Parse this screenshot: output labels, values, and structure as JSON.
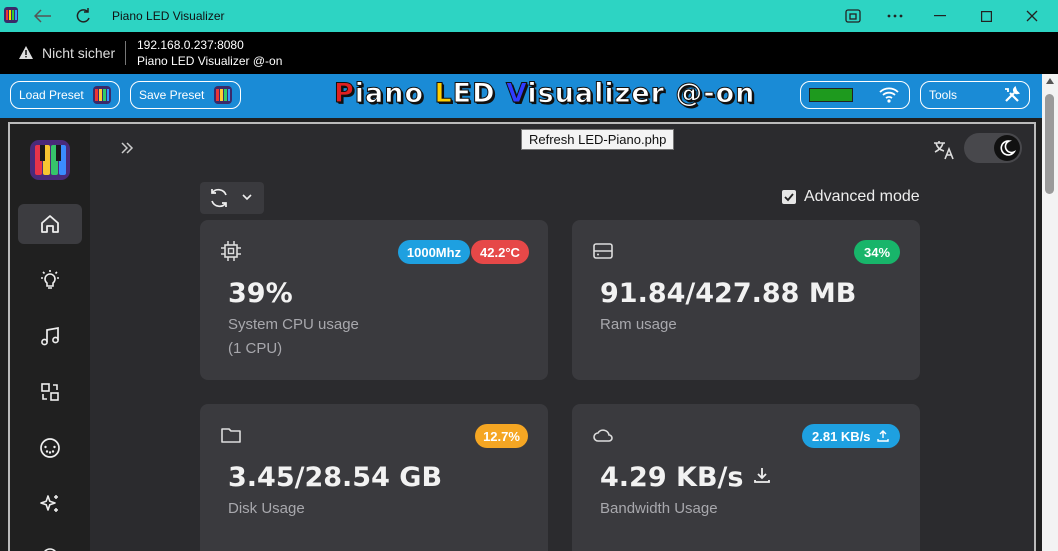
{
  "window": {
    "title": "Piano LED Visualizer"
  },
  "address": {
    "security": "Nicht sicher",
    "url": "192.168.0.237:8080",
    "page_title": "Piano LED Visualizer @-on"
  },
  "header": {
    "load_preset": "Load Preset",
    "save_preset": "Save Preset",
    "brand": {
      "p": "P",
      "iano": "iano ",
      "l": "L",
      "ed": "ED ",
      "v": "V",
      "isualizer": "isualizer @-on"
    },
    "tools": "Tools",
    "status_color": "#1e9a1e"
  },
  "tooltip": "Refresh LED-Piano.php",
  "advanced_mode": {
    "label": "Advanced mode",
    "checked": true
  },
  "cards": {
    "cpu": {
      "value": "39%",
      "label": "System CPU usage",
      "label2": "(1 CPU)",
      "freq": "1000Mhz",
      "temp": "42.2°C"
    },
    "ram": {
      "value": "91.84/427.88 MB",
      "label": "Ram usage",
      "badge": "34%"
    },
    "disk": {
      "value": "3.45/28.54 GB",
      "label": "Disk Usage",
      "badge": "12.7%"
    },
    "bandwidth": {
      "value": "4.29 KB/s",
      "label": "Bandwidth Usage",
      "badge": "2.81 KB/s"
    }
  },
  "colors": {
    "header_blue": "#1a8bd6",
    "titlebar": "#2dd4c3",
    "badge_blue": "#1ea0e0",
    "badge_red": "#e64848",
    "badge_green": "#18b56a",
    "badge_orange": "#f5a623"
  },
  "icons": [
    "home-icon",
    "bulb-icon",
    "music-icon",
    "ports-icon",
    "midi-icon",
    "sparkles-icon"
  ]
}
